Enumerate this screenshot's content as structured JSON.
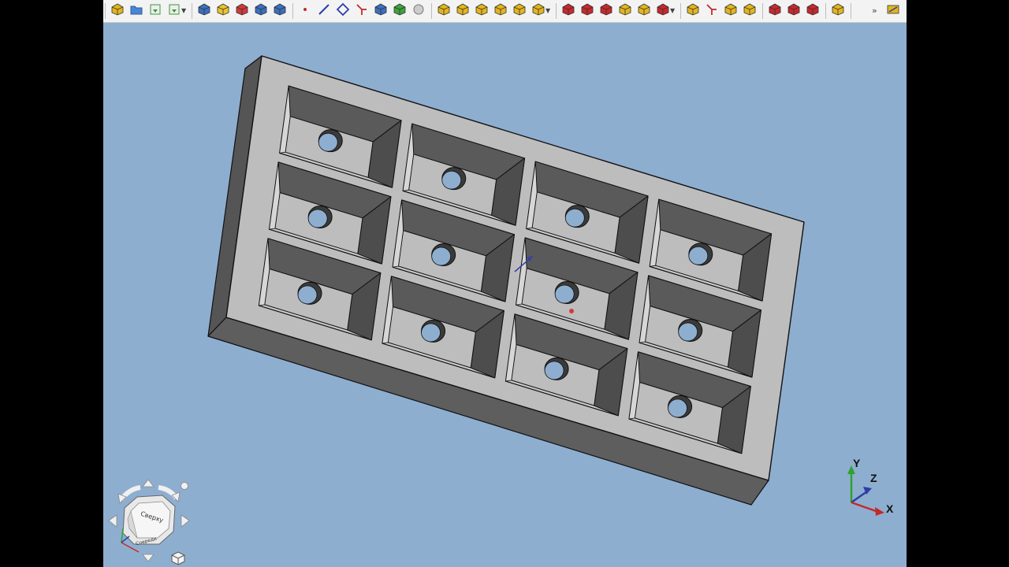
{
  "toolbar": {
    "groups": [
      {
        "name": "file",
        "icons": [
          "new-file-icon",
          "open-file-icon",
          "save-icon",
          "save-as-icon"
        ]
      },
      {
        "name": "part",
        "icons": [
          "create-body-icon",
          "create-sketch-icon",
          "import-icon",
          "part-view-icon",
          "validate-sketch-icon"
        ]
      },
      {
        "name": "sketch",
        "icons": [
          "point-icon",
          "line-icon",
          "polyline-icon",
          "constraint-icon",
          "body-icon",
          "green-body-icon",
          "shape-binder-icon"
        ]
      },
      {
        "name": "features",
        "icons": [
          "pad-icon",
          "revolution-icon",
          "loft-icon",
          "pipe-icon",
          "helix-icon",
          "additive-box-icon"
        ]
      },
      {
        "name": "subtractive",
        "icons": [
          "pocket-icon",
          "hole-icon",
          "groove-icon",
          "subtractive-loft-icon",
          "subtractive-pipe-icon",
          "subtractive-box-icon"
        ]
      },
      {
        "name": "pattern",
        "icons": [
          "mirror-icon",
          "linear-pattern-icon",
          "polar-pattern-icon",
          "multi-transform-icon"
        ]
      },
      {
        "name": "dressup",
        "icons": [
          "fillet-icon",
          "chamfer-icon",
          "draft-icon"
        ]
      },
      {
        "name": "misc",
        "icons": [
          "measure-icon"
        ]
      }
    ],
    "overflow_label": "»"
  },
  "viewport": {
    "background": "#8eaed0",
    "model": "plate with 12 recessed pockets, each with a through hole",
    "pocket_rows": 3,
    "pocket_cols": 4
  },
  "navcube": {
    "face_label": "Сверху",
    "side_label": "Спереди"
  },
  "axes": {
    "x_label": "X",
    "y_label": "Y",
    "z_label": "Z"
  },
  "colors": {
    "plate_top": "#bdbdbd",
    "plate_left": "#555555",
    "plate_bottom": "#5e5e5e",
    "x_axis": "#c22a2a",
    "y_axis": "#2fa22f",
    "z_axis": "#2f3ea5"
  }
}
